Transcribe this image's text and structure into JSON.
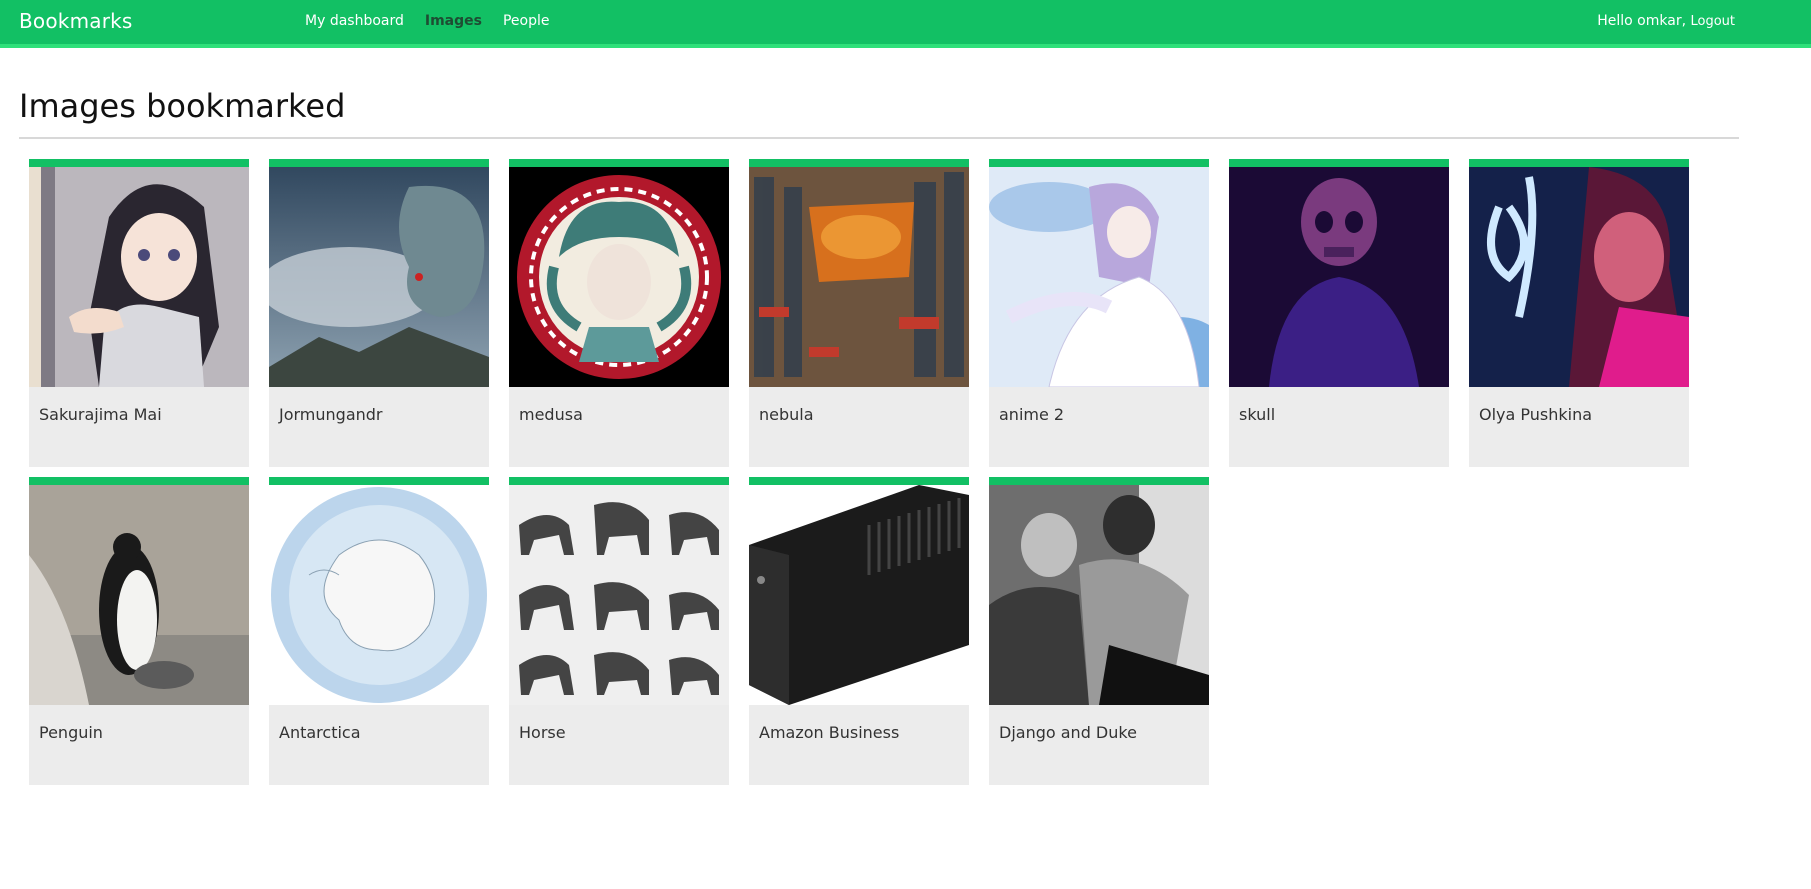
{
  "header": {
    "brand": "Bookmarks",
    "nav": [
      "My dashboard",
      "Images",
      "People"
    ],
    "active_nav": "Images",
    "greeting": "Hello omkar,",
    "logout": "Logout"
  },
  "page": {
    "title": "Images bookmarked"
  },
  "images": [
    {
      "title": "Sakurajima Mai",
      "icon": "anime-girl-image"
    },
    {
      "title": "Jormungandr",
      "icon": "serpent-image"
    },
    {
      "title": "medusa",
      "icon": "medusa-image"
    },
    {
      "title": "nebula",
      "icon": "city-sky-image"
    },
    {
      "title": "anime 2",
      "icon": "anime-girl-white-dress-image"
    },
    {
      "title": "skull",
      "icon": "skull-image"
    },
    {
      "title": "Olya Pushkina",
      "icon": "neon-portrait-image"
    },
    {
      "title": "Penguin",
      "icon": "penguin-image"
    },
    {
      "title": "Antarctica",
      "icon": "antarctica-map-image"
    },
    {
      "title": "Horse",
      "icon": "horse-engravings-image"
    },
    {
      "title": "Amazon Business",
      "icon": "ups-device-image"
    },
    {
      "title": "Django and Duke",
      "icon": "piano-photo-image"
    }
  ],
  "colors": {
    "accent": "#12c064",
    "card_bg": "#ececec"
  }
}
